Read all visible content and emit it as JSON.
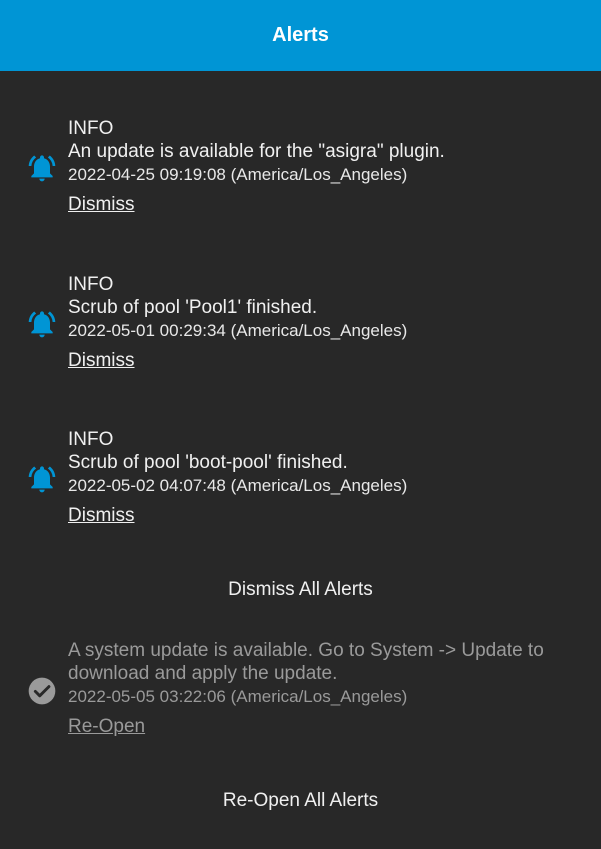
{
  "header": {
    "title": "Alerts"
  },
  "active_alerts": [
    {
      "level": "INFO",
      "message": "An update is available for the \"asigra\" plugin.",
      "timestamp": "2022-04-25 09:19:08 (America/Los_Angeles)",
      "action": "Dismiss",
      "icon": "bell-icon"
    },
    {
      "level": "INFO",
      "message": "Scrub of pool 'Pool1' finished.",
      "timestamp": "2022-05-01 00:29:34 (America/Los_Angeles)",
      "action": "Dismiss",
      "icon": "bell-icon"
    },
    {
      "level": "INFO",
      "message": "Scrub of pool 'boot-pool' finished.",
      "timestamp": "2022-05-02 04:07:48 (America/Los_Angeles)",
      "action": "Dismiss",
      "icon": "bell-icon"
    }
  ],
  "dismiss_all_label": "Dismiss All Alerts",
  "dismissed_alerts": [
    {
      "message": "A system update is available. Go to System -> Update to download and apply the update.",
      "timestamp": "2022-05-05 03:22:06 (America/Los_Angeles)",
      "action": "Re-Open",
      "icon": "check-circle-icon"
    }
  ],
  "reopen_all_label": "Re-Open All Alerts",
  "colors": {
    "header_bg": "#0095d5",
    "panel_bg": "#282828",
    "bell": "#0095d5",
    "dismissed_text": "#9a9a9a"
  }
}
